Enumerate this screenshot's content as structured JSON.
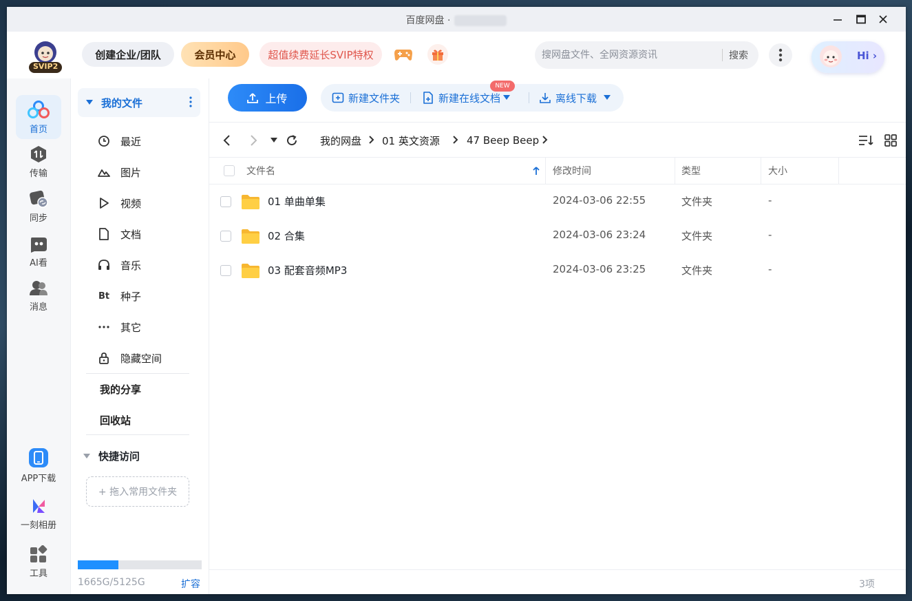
{
  "window": {
    "title": "百度网盘 ·"
  },
  "header": {
    "svip_badge": "SVIP2",
    "team_button": "创建企业/团队",
    "vip_center": "会员中心",
    "renew_promo": "超值续费延长SVIP特权",
    "search_placeholder": "搜网盘文件、全网资源资讯",
    "search_button": "搜索",
    "greeting": "Hi ›"
  },
  "rail": {
    "items": [
      {
        "label": "首页"
      },
      {
        "label": "传输"
      },
      {
        "label": "同步"
      },
      {
        "label": "AI看"
      },
      {
        "label": "消息"
      },
      {
        "label": "APP下载"
      },
      {
        "label": "一刻相册"
      },
      {
        "label": "工具"
      }
    ]
  },
  "sidebar": {
    "my_files": "我的文件",
    "items": [
      {
        "label": "最近"
      },
      {
        "label": "图片"
      },
      {
        "label": "视频"
      },
      {
        "label": "文档"
      },
      {
        "label": "音乐"
      },
      {
        "label": "种子",
        "icon_text": "Bt"
      },
      {
        "label": "其它"
      },
      {
        "label": "隐藏空间"
      }
    ],
    "my_share": "我的分享",
    "recycle": "回收站",
    "quick_access": "快捷访问",
    "drop_hint": "+ 拖入常用文件夹",
    "storage": {
      "used_total": "1665G/5125G",
      "used_fraction": 0.325,
      "expand": "扩容"
    }
  },
  "toolbar": {
    "upload": "上传",
    "new_folder": "新建文件夹",
    "new_online_doc": "新建在线文档",
    "new_badge": "NEW",
    "offline_download": "离线下载"
  },
  "breadcrumb": [
    "我的网盘",
    "01 英文资源",
    "47 Beep Beep"
  ],
  "table": {
    "headers": {
      "name": "文件名",
      "mtime": "修改时间",
      "type": "类型",
      "size": "大小"
    },
    "rows": [
      {
        "name": "01 单曲单集",
        "mtime": "2024-03-06 22:55",
        "type": "文件夹",
        "size": "-"
      },
      {
        "name": "02 合集",
        "mtime": "2024-03-06 23:24",
        "type": "文件夹",
        "size": "-"
      },
      {
        "name": "03 配套音频MP3",
        "mtime": "2024-03-06 23:25",
        "type": "文件夹",
        "size": "-"
      }
    ]
  },
  "status": {
    "count": "3项"
  },
  "colors": {
    "accent": "#1a6fd6",
    "folder": "#ffc83d",
    "vip_gold": "#ffc98a",
    "promo_red": "#e0584e"
  }
}
